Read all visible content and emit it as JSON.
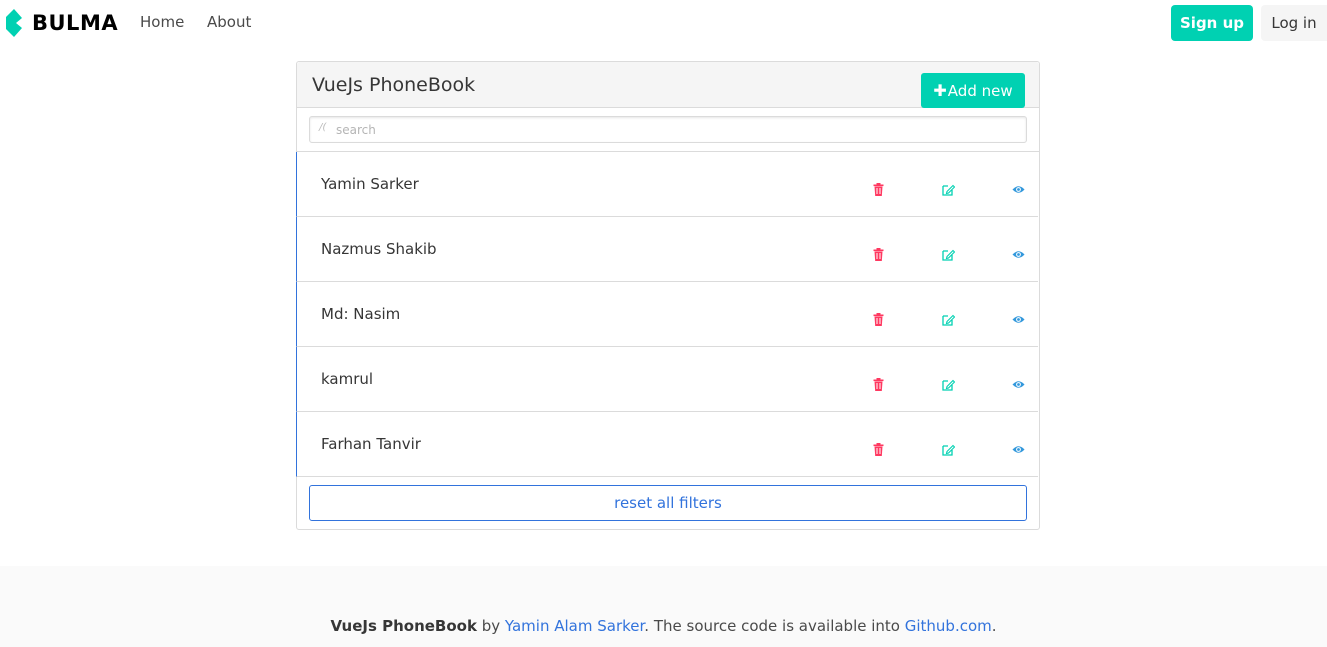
{
  "navbar": {
    "brand": "BULMA",
    "brand_color": "#00d1b2",
    "links": [
      {
        "label": "Home"
      },
      {
        "label": "About"
      }
    ],
    "signup_label": "Sign up",
    "login_label": "Log in"
  },
  "panel": {
    "title": "VueJs PhoneBook",
    "add_label": "Add new",
    "add_icon": "plus-icon",
    "search": {
      "placeholder": "search",
      "value": "",
      "icon": "search-icon"
    },
    "contacts": [
      {
        "name": "Yamin Sarker"
      },
      {
        "name": "Nazmus Shakib"
      },
      {
        "name": "Md: Nasim"
      },
      {
        "name": "kamrul"
      },
      {
        "name": "Farhan Tanvir"
      }
    ],
    "row_actions": [
      {
        "icon": "trash-icon",
        "color": "#ff3860"
      },
      {
        "icon": "edit-icon",
        "color": "#00d1b2"
      },
      {
        "icon": "eye-icon",
        "color": "#3298dc"
      }
    ],
    "reset_label": "reset all filters"
  },
  "footer": {
    "app_name": "VueJs PhoneBook",
    "by": " by ",
    "author": "Yamin Alam Sarker",
    "middle": ". The source code is available into ",
    "repo_link": "Github.com",
    "end": "."
  },
  "colors": {
    "primary": "#00d1b2",
    "link": "#3273dc",
    "danger": "#ff3860",
    "info": "#3298dc"
  }
}
